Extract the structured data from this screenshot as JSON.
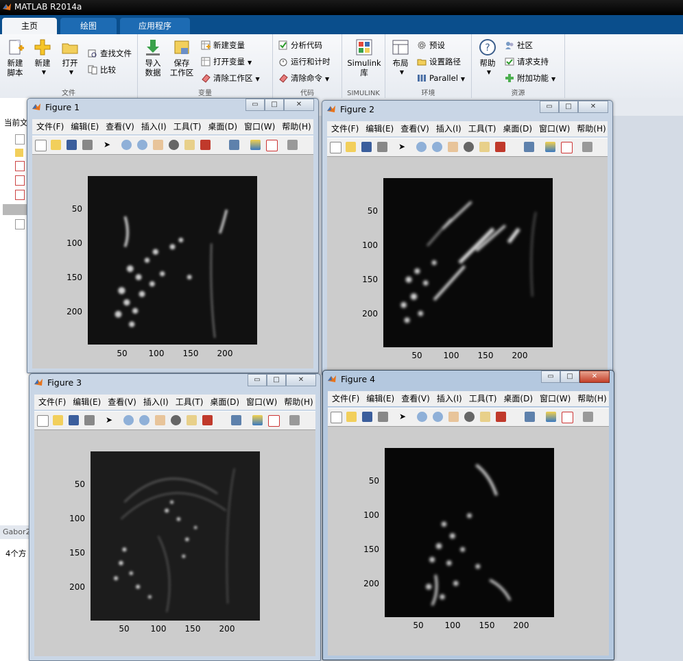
{
  "app": {
    "title": "MATLAB R2014a"
  },
  "tabs": [
    {
      "label": "主页"
    },
    {
      "label": "绘图"
    },
    {
      "label": "应用程序"
    }
  ],
  "ribbon": {
    "file": {
      "group": "文件",
      "new_script": "新建\n脚本",
      "new": "新建",
      "open": "打开",
      "find_files": "查找文件",
      "compare": "比较"
    },
    "variable": {
      "group": "变量",
      "import": "导入\n数据",
      "save_ws": "保存\n工作区",
      "new_var": "新建变量",
      "open_var": "打开变量",
      "clear_ws": "清除工作区"
    },
    "code": {
      "group": "代码",
      "analyze": "分析代码",
      "run_time": "运行和计时",
      "clear_cmd": "清除命令"
    },
    "simulink": {
      "group": "SIMULINK",
      "lib": "Simulink\n库"
    },
    "env": {
      "group": "环境",
      "layout": "布局",
      "prefs": "预设",
      "set_path": "设置路径",
      "parallel": "Parallel"
    },
    "resources": {
      "group": "资源",
      "help": "帮助",
      "community": "社区",
      "request_support": "请求支持",
      "addons": "附加功能"
    }
  },
  "leftpanel": {
    "current_folder": "当前文",
    "gabor": "Gabor2",
    "count": "4个方"
  },
  "figure_menu": [
    "文件(F)",
    "编辑(E)",
    "查看(V)",
    "插入(I)",
    "工具(T)",
    "桌面(D)",
    "窗口(W)",
    "帮助(H)"
  ],
  "figures": [
    {
      "title": "Figure 1",
      "yticks": [
        "50",
        "100",
        "150",
        "200"
      ],
      "xticks": [
        "50",
        "100",
        "150",
        "200"
      ]
    },
    {
      "title": "Figure 2",
      "yticks": [
        "50",
        "100",
        "150",
        "200"
      ],
      "xticks": [
        "50",
        "100",
        "150",
        "200"
      ]
    },
    {
      "title": "Figure 3",
      "yticks": [
        "50",
        "100",
        "150",
        "200"
      ],
      "xticks": [
        "50",
        "100",
        "150",
        "200"
      ]
    },
    {
      "title": "Figure 4",
      "yticks": [
        "50",
        "100",
        "150",
        "200"
      ],
      "xticks": [
        "50",
        "100",
        "150",
        "200"
      ]
    }
  ],
  "window_buttons": {
    "minimize": "▭",
    "maximize": "□",
    "close": "✕"
  },
  "colors": {
    "title_bar": "#000000",
    "tab_bar": "#0a4e8c",
    "active_close": "#c4402a",
    "canvas": "#cccccc"
  },
  "icons": [
    "matlab-logo-icon",
    "new-figure-icon",
    "open-icon",
    "save-icon",
    "print-icon",
    "pointer-icon",
    "zoom-in-icon",
    "zoom-out-icon",
    "pan-icon",
    "rotate-icon",
    "data-cursor-icon",
    "brush-icon",
    "link-icon",
    "colorbar-icon",
    "legend-icon",
    "plot-tools-icon"
  ]
}
